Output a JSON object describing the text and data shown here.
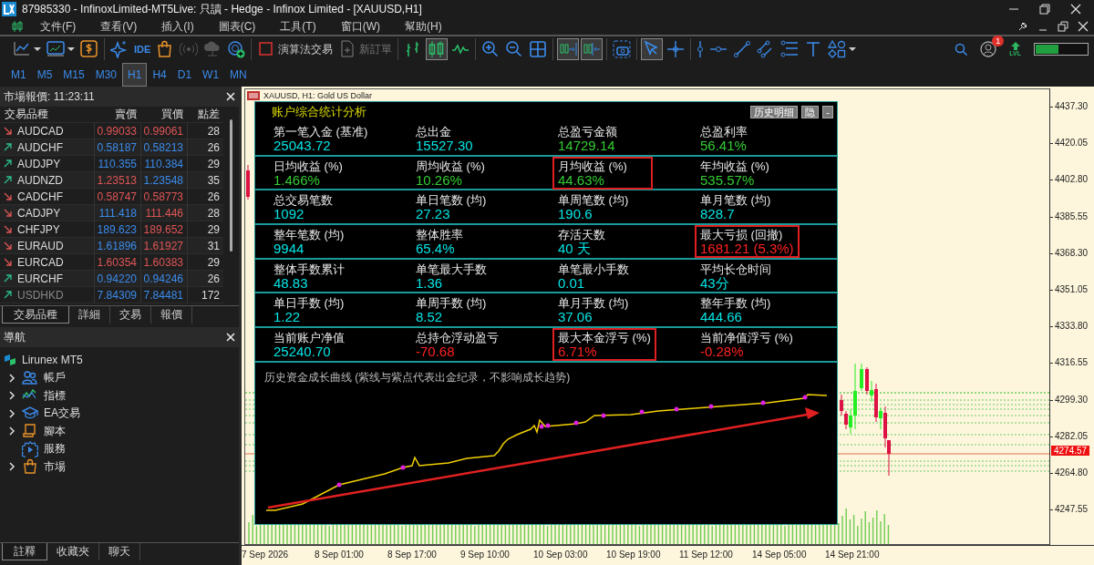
{
  "window": {
    "title": "87985330 - InfinoxLimited-MT5Live: 只讀 - Hedge - Infinox Limited - [XAUUSD,H1]"
  },
  "menu": [
    "文件(F)",
    "查看(V)",
    "插入(I)",
    "圖表(C)",
    "工具(T)",
    "窗口(W)",
    "幫助(H)"
  ],
  "toolbar": [
    [
      {
        "selected": false,
        "disabled": false,
        "dropdown": true
      },
      {
        "selected": false,
        "disabled": false,
        "dropdown": true
      },
      {
        "selected": false,
        "disabled": false
      }
    ],
    [
      {
        "selected": false,
        "disabled": false
      },
      {
        "selected": false,
        "disabled": false,
        "label": "IDE"
      },
      {
        "selected": false,
        "disabled": false
      },
      {
        "selected": false,
        "disabled": true
      },
      {
        "selected": false,
        "disabled": true
      },
      {
        "selected": false,
        "disabled": false
      }
    ],
    [
      {
        "selected": false,
        "disabled": false,
        "label": "演算法交易"
      },
      {
        "selected": false,
        "disabled": true,
        "label": "新訂單"
      }
    ],
    [
      {
        "selected": false,
        "disabled": false
      },
      {
        "selected": true,
        "disabled": false
      },
      {
        "selected": false,
        "disabled": false
      }
    ],
    [
      {
        "selected": false,
        "disabled": false
      },
      {
        "selected": false,
        "disabled": false
      },
      {
        "selected": false,
        "disabled": false
      }
    ],
    [
      {
        "selected": true,
        "disabled": false
      },
      {
        "selected": true,
        "disabled": false
      }
    ],
    [
      {
        "selected": false,
        "disabled": false
      }
    ],
    [
      {
        "selected": true,
        "disabled": false
      },
      {
        "selected": false,
        "disabled": false
      }
    ],
    [
      {
        "selected": false,
        "disabled": false
      },
      {
        "selected": false,
        "disabled": false
      },
      {
        "selected": false,
        "disabled": false
      },
      {
        "selected": false,
        "disabled": false
      },
      {
        "selected": false,
        "disabled": false
      },
      {
        "selected": false,
        "disabled": false
      },
      {
        "selected": false,
        "disabled": false,
        "dropdown": true
      }
    ]
  ],
  "notifications": {
    "badge": "1"
  },
  "level_meter": {
    "label": "LVL",
    "level": 0.45
  },
  "timeframes": [
    {
      "label": "M1",
      "selected": false
    },
    {
      "label": "M5",
      "selected": false
    },
    {
      "label": "M15",
      "selected": false
    },
    {
      "label": "M30",
      "selected": false
    },
    {
      "label": "H1",
      "selected": true
    },
    {
      "label": "H4",
      "selected": false
    },
    {
      "label": "D1",
      "selected": false
    },
    {
      "label": "W1",
      "selected": false
    },
    {
      "label": "MN",
      "selected": false
    }
  ],
  "market_watch": {
    "title": "市場報價: 11:23:11",
    "columns": [
      "交易品種",
      "賣價",
      "買價",
      "點差"
    ],
    "rows": [
      {
        "symbol": "AUDCAD",
        "rising": false,
        "bid": "0.99033",
        "bid_up": false,
        "ask": "0.99061",
        "ask_up": false,
        "spread": "28"
      },
      {
        "symbol": "AUDCHF",
        "rising": true,
        "bid": "0.58187",
        "bid_up": true,
        "ask": "0.58213",
        "ask_up": true,
        "spread": "26"
      },
      {
        "symbol": "AUDJPY",
        "rising": true,
        "bid": "110.355",
        "bid_up": true,
        "ask": "110.384",
        "ask_up": true,
        "spread": "29"
      },
      {
        "symbol": "AUDNZD",
        "rising": true,
        "bid": "1.23513",
        "bid_up": false,
        "ask": "1.23548",
        "ask_up": true,
        "spread": "35"
      },
      {
        "symbol": "CADCHF",
        "rising": false,
        "bid": "0.58747",
        "bid_up": false,
        "ask": "0.58773",
        "ask_up": false,
        "spread": "26"
      },
      {
        "symbol": "CADJPY",
        "rising": false,
        "bid": "111.418",
        "bid_up": true,
        "ask": "111.446",
        "ask_up": false,
        "spread": "28"
      },
      {
        "symbol": "CHFJPY",
        "rising": false,
        "bid": "189.623",
        "bid_up": true,
        "ask": "189.652",
        "ask_up": false,
        "spread": "29"
      },
      {
        "symbol": "EURAUD",
        "rising": false,
        "bid": "1.61896",
        "bid_up": true,
        "ask": "1.61927",
        "ask_up": false,
        "spread": "31"
      },
      {
        "symbol": "EURCAD",
        "rising": false,
        "bid": "1.60354",
        "bid_up": false,
        "ask": "1.60383",
        "ask_up": false,
        "spread": "29"
      },
      {
        "symbol": "EURCHF",
        "rising": true,
        "bid": "0.94220",
        "bid_up": true,
        "ask": "0.94246",
        "ask_up": true,
        "spread": "26"
      },
      {
        "symbol": "USDHKD",
        "rising": true,
        "bid": "7.84309",
        "bid_up": true,
        "ask": "7.84481",
        "ask_up": true,
        "spread": "172"
      }
    ],
    "tabs": [
      {
        "label": "交易品種",
        "selected": true
      },
      {
        "label": "詳細",
        "selected": false
      },
      {
        "label": "交易",
        "selected": false
      },
      {
        "label": "報價",
        "selected": false
      }
    ]
  },
  "navigator": {
    "title": "導航",
    "root": {
      "label": "Lirunex MT5",
      "children": [
        {
          "label": "帳戶",
          "expandable": true
        },
        {
          "label": "指標",
          "expandable": true
        },
        {
          "label": "EA交易",
          "expandable": true
        },
        {
          "label": "腳本",
          "expandable": true
        },
        {
          "label": "服務",
          "expandable": false
        },
        {
          "label": "市場",
          "expandable": true
        }
      ]
    },
    "tabs": [
      {
        "label": "註釋",
        "selected": true
      },
      {
        "label": "收藏夾",
        "selected": false
      },
      {
        "label": "聊天",
        "selected": false
      }
    ]
  },
  "chart": {
    "title": "XAUUSD, H1:  Gold US Dollar",
    "price_ticks": [
      "4437.30",
      "4420.05",
      "4402.80",
      "4385.55",
      "4368.30",
      "4351.05",
      "4333.80",
      "4316.55",
      "4299.30",
      "4282.05",
      "4264.80",
      "4247.55"
    ],
    "current_price": "4274.57",
    "time_ticks": [
      "7 Sep 2026",
      "8 Sep 01:00",
      "8 Sep 17:00",
      "9 Sep 10:00",
      "10 Sep 03:00",
      "10 Sep 19:00",
      "11 Sep 12:00",
      "14 Sep 05:00",
      "14 Sep 21:00"
    ]
  },
  "stats_panel": {
    "title": "账户综合统计分析",
    "buttons": [
      "历史明细",
      "隐",
      "-"
    ],
    "rows": [
      [
        {
          "label": "第一笔入金 (基准)",
          "value": "25043.72",
          "color": "#00e5e5",
          "highlighted": false
        },
        {
          "label": "总出金",
          "value": "15527.30",
          "color": "#00e5e5",
          "highlighted": false
        },
        {
          "label": "总盈亏金额",
          "value": "14729.14",
          "color": "#33cc33",
          "highlighted": false
        },
        {
          "label": "总盈利率",
          "value": "56.41%",
          "color": "#33cc33",
          "highlighted": false
        }
      ],
      [
        {
          "label": "日均收益 (%)",
          "value": "1.466%",
          "color": "#33cc33",
          "highlighted": false
        },
        {
          "label": "周均收益 (%)",
          "value": "10.26%",
          "color": "#33cc33",
          "highlighted": false
        },
        {
          "label": "月均收益 (%)",
          "value": "44.63%",
          "color": "#33cc33",
          "highlighted": true
        },
        {
          "label": "年均收益 (%)",
          "value": "535.57%",
          "color": "#33cc33",
          "highlighted": false
        }
      ],
      [
        {
          "label": "总交易笔数",
          "value": "1092",
          "color": "#00e5e5",
          "highlighted": false
        },
        {
          "label": "单日笔数 (均)",
          "value": "27.23",
          "color": "#00e5e5",
          "highlighted": false
        },
        {
          "label": "单周笔数 (均)",
          "value": "190.6",
          "color": "#00e5e5",
          "highlighted": false
        },
        {
          "label": "单月笔数 (均)",
          "value": "828.7",
          "color": "#00e5e5",
          "highlighted": false
        }
      ],
      [
        {
          "label": "整年笔数 (均)",
          "value": "9944",
          "color": "#00e5e5",
          "highlighted": false
        },
        {
          "label": "整体胜率",
          "value": "65.4%",
          "color": "#00e5e5",
          "highlighted": false
        },
        {
          "label": "存活天数",
          "value": "40 天",
          "color": "#00e5e5",
          "highlighted": false
        },
        {
          "label": "最大亏损 (回撤)",
          "value": "1681.21 (5.3%)",
          "color": "#ff2020",
          "highlighted": true
        }
      ],
      [
        {
          "label": "整体手数累计",
          "value": "48.83",
          "color": "#00e5e5",
          "highlighted": false
        },
        {
          "label": "单笔最大手数",
          "value": "1.36",
          "color": "#00e5e5",
          "highlighted": false
        },
        {
          "label": "单笔最小手数",
          "value": "0.01",
          "color": "#00e5e5",
          "highlighted": false
        },
        {
          "label": "平均长仓时间",
          "value": "43分",
          "color": "#00e5e5",
          "highlighted": false
        }
      ],
      [
        {
          "label": "单日手数 (均)",
          "value": "1.22",
          "color": "#00e5e5",
          "highlighted": false
        },
        {
          "label": "单周手数 (均)",
          "value": "8.52",
          "color": "#00e5e5",
          "highlighted": false
        },
        {
          "label": "单月手数 (均)",
          "value": "37.06",
          "color": "#00e5e5",
          "highlighted": false
        },
        {
          "label": "整年手数 (均)",
          "value": "444.66",
          "color": "#00e5e5",
          "highlighted": false
        }
      ],
      [
        {
          "label": "当前账户净值",
          "value": "25240.70",
          "color": "#00e5e5",
          "highlighted": false
        },
        {
          "label": "总持仓浮动盈亏",
          "value": "-70.68",
          "color": "#ff2020",
          "highlighted": false
        },
        {
          "label": "最大本金浮亏 (%)",
          "value": "6.71%",
          "color": "#ff2020",
          "highlighted": true
        },
        {
          "label": "当前净值浮亏 (%)",
          "value": "-0.28%",
          "color": "#ff2020",
          "highlighted": false
        }
      ]
    ],
    "curve_caption": "历史资金成长曲线 (紫线与紫点代表出金纪录，不影响成长趋势)"
  }
}
